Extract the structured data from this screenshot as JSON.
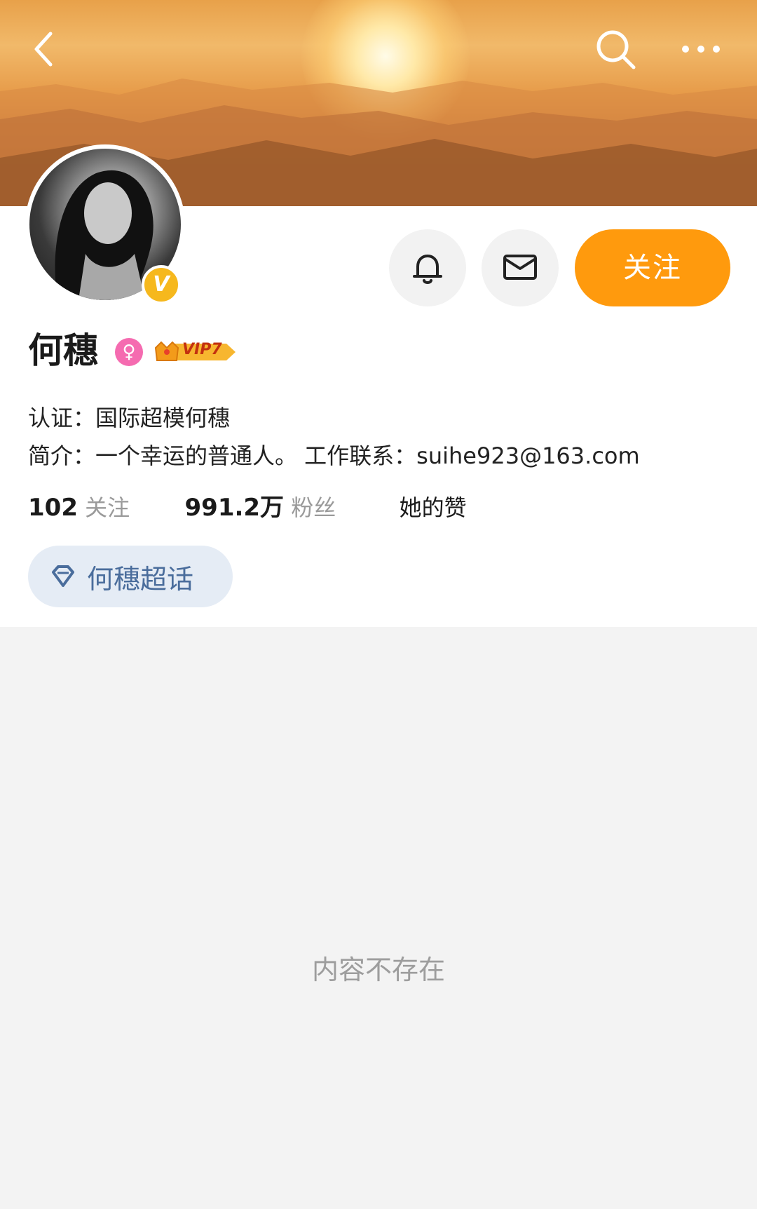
{
  "nav": {
    "back_icon": "chevron-left-icon",
    "search_icon": "search-icon",
    "more_icon": "more-dots-icon"
  },
  "profile": {
    "name": "何穗",
    "verified_badge": "V",
    "gender_icon": "female-icon",
    "vip_label": "VIP7",
    "certification": "认证：国际超模何穗",
    "bio": "简介：一个幸运的普通人。 工作联系：suihe923@163.com"
  },
  "actions": {
    "bell_icon": "bell-icon",
    "message_icon": "message-icon",
    "follow_label": "关注"
  },
  "stats": {
    "following_count": "102",
    "following_label": "关注",
    "followers_count": "991.2万",
    "followers_label": "粉丝",
    "likes_label": "她的赞"
  },
  "super_topic": {
    "icon": "diamond-icon",
    "label": "何穗超话"
  },
  "content": {
    "empty_message": "内容不存在"
  },
  "colors": {
    "accent": "#ff9a0d",
    "verified": "#f6b81d",
    "gender": "#f56bb0",
    "topic_bg": "#e5ecf5",
    "topic_text": "#4a6d9c"
  }
}
